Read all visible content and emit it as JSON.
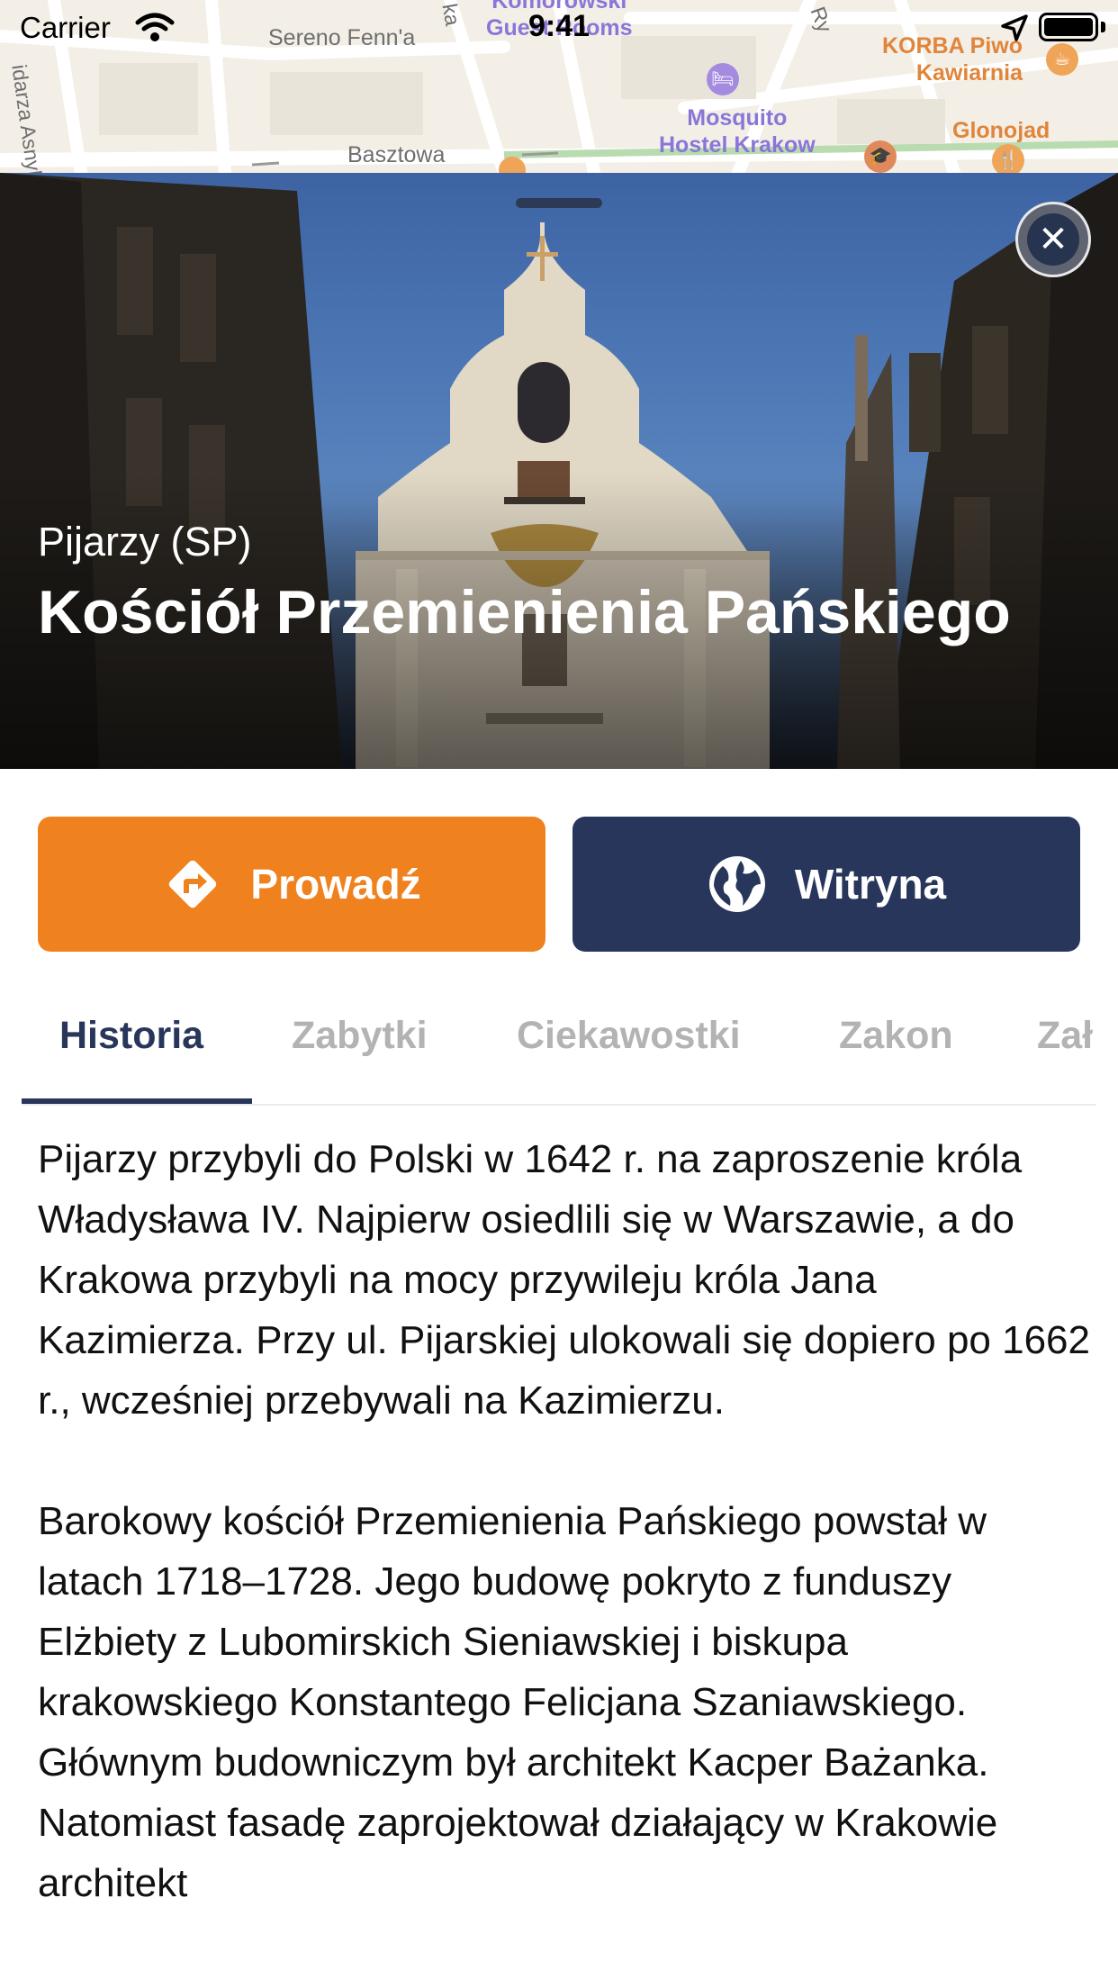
{
  "status_bar": {
    "carrier": "Carrier",
    "time": "9:41"
  },
  "map": {
    "streets": [
      "Sereno Fenn'a",
      "Basztowa",
      "idarza Asnyka",
      "ka",
      "Ry"
    ],
    "pois": [
      {
        "name": "Komorowski Guest Rooms",
        "line1": "Komorowski",
        "line2": "Guest Rooms",
        "color": "#8a76d8"
      },
      {
        "name": "Mosquito Hostel Krakow",
        "line1": "Mosquito",
        "line2": "Hostel Krakow",
        "color": "#8a76d8"
      },
      {
        "name": "KORBA Piwo Kawiarnia",
        "line1": "KORBA Piwo",
        "line2": "Kawiarnia",
        "color": "#e0853a"
      },
      {
        "name": "Glonojad",
        "line1": "Glonojad",
        "line2": "",
        "color": "#e0853a"
      }
    ]
  },
  "header": {
    "order": "Pijarzy (SP)",
    "title": "Kościół Przemienienia Pańskiego"
  },
  "actions": {
    "navigate_label": "Prowadź",
    "website_label": "Witryna",
    "colors": {
      "navigate": "#ef821f",
      "website": "#27365a"
    }
  },
  "tabs": [
    {
      "label": "Historia",
      "active": true
    },
    {
      "label": "Zabytki",
      "active": false
    },
    {
      "label": "Ciekawostki",
      "active": false
    },
    {
      "label": "Zakon",
      "active": false
    },
    {
      "label": "Zał",
      "active": false
    }
  ],
  "content": {
    "paragraphs": [
      "Pijarzy przybyli do Polski w 1642 r. na zaproszenie króla Władysława IV. Najpierw osiedlili się w Warszawie, a do Krakowa przybyli na mocy przywileju króla Jana Kazimierza. Przy ul. Pijarskiej ulokowali się dopiero po 1662 r., wcześniej przebywali na Kazimierzu.",
      "Barokowy kościół Przemienienia Pańskiego powstał w latach 1718–1728. Jego budowę pokryto z funduszy Elżbiety z Lubomirskich Sieniawskiej i biskupa krakowskiego Konstantego Felicjana Szaniawskiego. Głównym budowniczym był architekt Kacper Bażanka. Natomiast fasadę zaprojektował działający w Krakowie architekt"
    ]
  }
}
